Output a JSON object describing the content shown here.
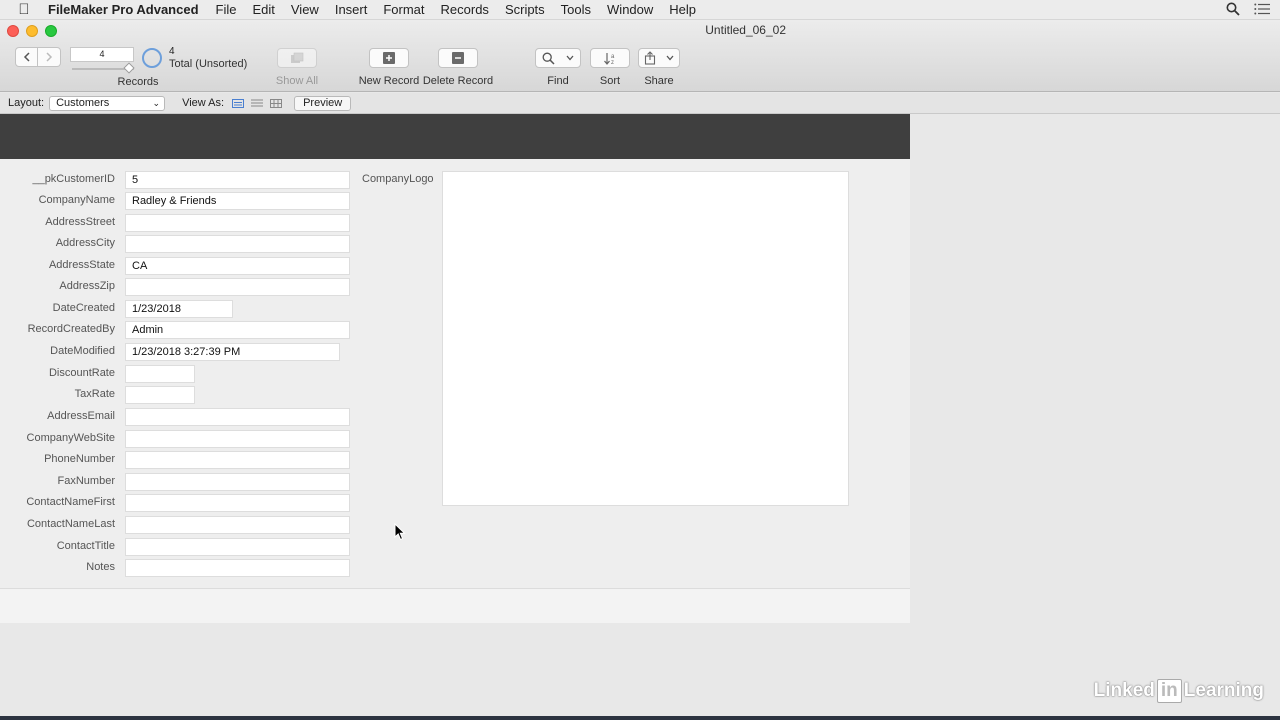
{
  "menubar": {
    "app_name": "FileMaker Pro Advanced",
    "items": [
      "File",
      "Edit",
      "View",
      "Insert",
      "Format",
      "Records",
      "Scripts",
      "Tools",
      "Window",
      "Help"
    ]
  },
  "window": {
    "title": "Untitled_06_02"
  },
  "toolbar": {
    "current_record": "4",
    "found_count": "4",
    "total_label": "Total (Unsorted)",
    "records_label": "Records",
    "show_all": "Show All",
    "new_record": "New Record",
    "delete_record": "Delete Record",
    "find": "Find",
    "sort": "Sort",
    "share": "Share"
  },
  "layoutbar": {
    "layout_label": "Layout:",
    "layout_value": "Customers",
    "view_as_label": "View As:",
    "preview": "Preview"
  },
  "fields": [
    {
      "label": "__pkCustomerID",
      "value": "5"
    },
    {
      "label": "CompanyName",
      "value": "Radley & Friends"
    },
    {
      "label": "AddressStreet",
      "value": ""
    },
    {
      "label": "AddressCity",
      "value": ""
    },
    {
      "label": "AddressState",
      "value": "CA"
    },
    {
      "label": "AddressZip",
      "value": ""
    },
    {
      "label": "DateCreated",
      "value": "1/23/2018"
    },
    {
      "label": "RecordCreatedBy",
      "value": "Admin"
    },
    {
      "label": "DateModified",
      "value": "1/23/2018 3:27:39 PM"
    },
    {
      "label": "DiscountRate",
      "value": ""
    },
    {
      "label": "TaxRate",
      "value": ""
    },
    {
      "label": "AddressEmail",
      "value": ""
    },
    {
      "label": "CompanyWebSite",
      "value": ""
    },
    {
      "label": "PhoneNumber",
      "value": ""
    },
    {
      "label": "FaxNumber",
      "value": ""
    },
    {
      "label": "ContactNameFirst",
      "value": ""
    },
    {
      "label": "ContactNameLast",
      "value": ""
    },
    {
      "label": "ContactTitle",
      "value": ""
    },
    {
      "label": "Notes",
      "value": ""
    }
  ],
  "logo_field": {
    "label": "CompanyLogo"
  },
  "watermark": {
    "part1": "Linked",
    "part2": "in",
    "part3": "Learning"
  }
}
